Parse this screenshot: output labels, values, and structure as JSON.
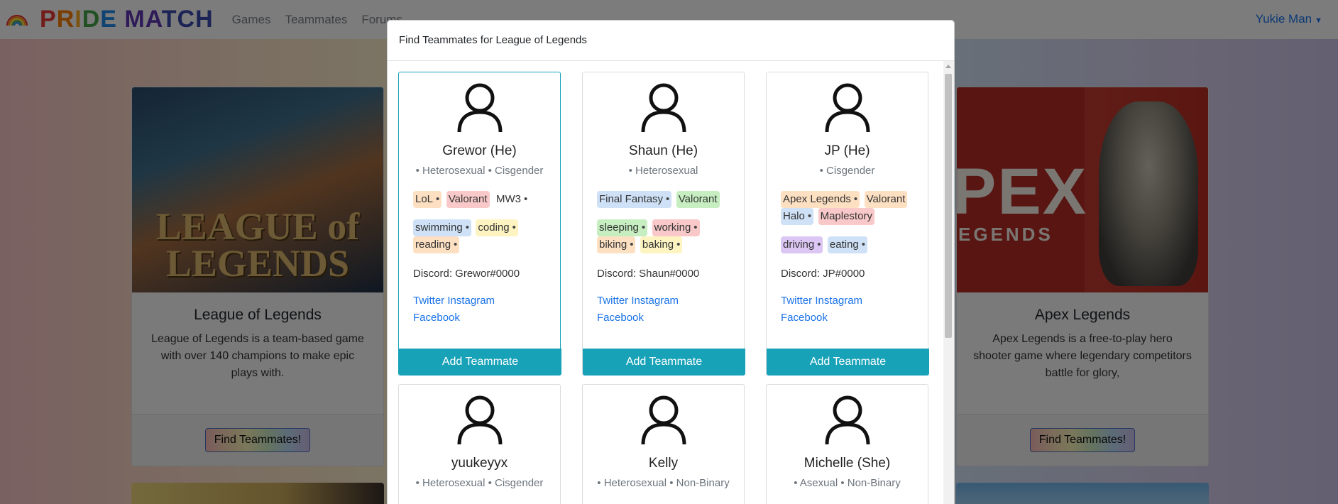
{
  "navbar": {
    "brand": "PRIDE MATCH",
    "links": [
      "Games",
      "Teammates",
      "Forums"
    ],
    "user": "Yukie Man"
  },
  "games": [
    {
      "title": "League of Legends",
      "description": "League of Legends is a team-based game with over 140 champions to make epic plays with.",
      "cover_text": "LEAGUE of LEGENDS",
      "button": "Find Teammates!"
    },
    {
      "title": "Apex Legends",
      "description": "Apex Legends is a free-to-play hero shooter game where legendary competitors battle for glory,",
      "cover_text": "PEX",
      "cover_subtext": "EGENDS",
      "button": "Find Teammates!"
    }
  ],
  "modal": {
    "title": "Find Teammates for League of Legends",
    "add_label": "Add Teammate",
    "teammates": [
      {
        "name": "Grewor (He)",
        "identity": "• Heterosexual • Cisgender",
        "games": [
          {
            "label": "LoL",
            "color": "#fde0c2"
          },
          {
            "label": "Valorant",
            "color": "#f9c9c9"
          },
          {
            "label": "MW3",
            "color": "#fdf4c2"
          }
        ],
        "interests": [
          {
            "label": "swimming",
            "color": "#cfe1f6"
          },
          {
            "label": "coding",
            "color": "#fdf4c2"
          },
          {
            "label": "reading",
            "color": "#fde0c2"
          }
        ],
        "discord": "Discord: Grewor#0000",
        "twitter": "Twitter",
        "instagram": "Instagram",
        "facebook": "Facebook"
      },
      {
        "name": "Shaun (He)",
        "identity": "• Heterosexual",
        "games": [
          {
            "label": "Final Fantasy",
            "color": "#cfe1f6"
          },
          {
            "label": "Valorant",
            "color": "#c6eec0"
          }
        ],
        "interests": [
          {
            "label": "sleeping",
            "color": "#c6eec0"
          },
          {
            "label": "working",
            "color": "#f9c9c9"
          },
          {
            "label": "biking",
            "color": "#fde0c2"
          },
          {
            "label": "baking",
            "color": "#fdf4c2"
          }
        ],
        "discord": "Discord: Shaun#0000",
        "twitter": "Twitter",
        "instagram": "Instagram",
        "facebook": "Facebook"
      },
      {
        "name": "JP (He)",
        "identity": "• Cisgender",
        "games": [
          {
            "label": "Apex Legends",
            "color": "#fde0c2"
          },
          {
            "label": "Valorant",
            "color": "#fde0c2"
          },
          {
            "label": "Halo",
            "color": "#cfe1f6"
          },
          {
            "label": "Maplestory",
            "color": "#f9c9c9"
          }
        ],
        "interests": [
          {
            "label": "driving",
            "color": "#dcc6f3"
          },
          {
            "label": "eating",
            "color": "#cfe1f6"
          }
        ],
        "discord": "Discord: JP#0000",
        "twitter": "Twitter",
        "instagram": "Instagram",
        "facebook": "Facebook"
      },
      {
        "name": "yuukeyyx",
        "identity": "• Heterosexual • Cisgender"
      },
      {
        "name": "Kelly",
        "identity": "• Heterosexual • Non-Binary"
      },
      {
        "name": "Michelle (She)",
        "identity": "• Asexual • Non-Binary"
      }
    ]
  }
}
